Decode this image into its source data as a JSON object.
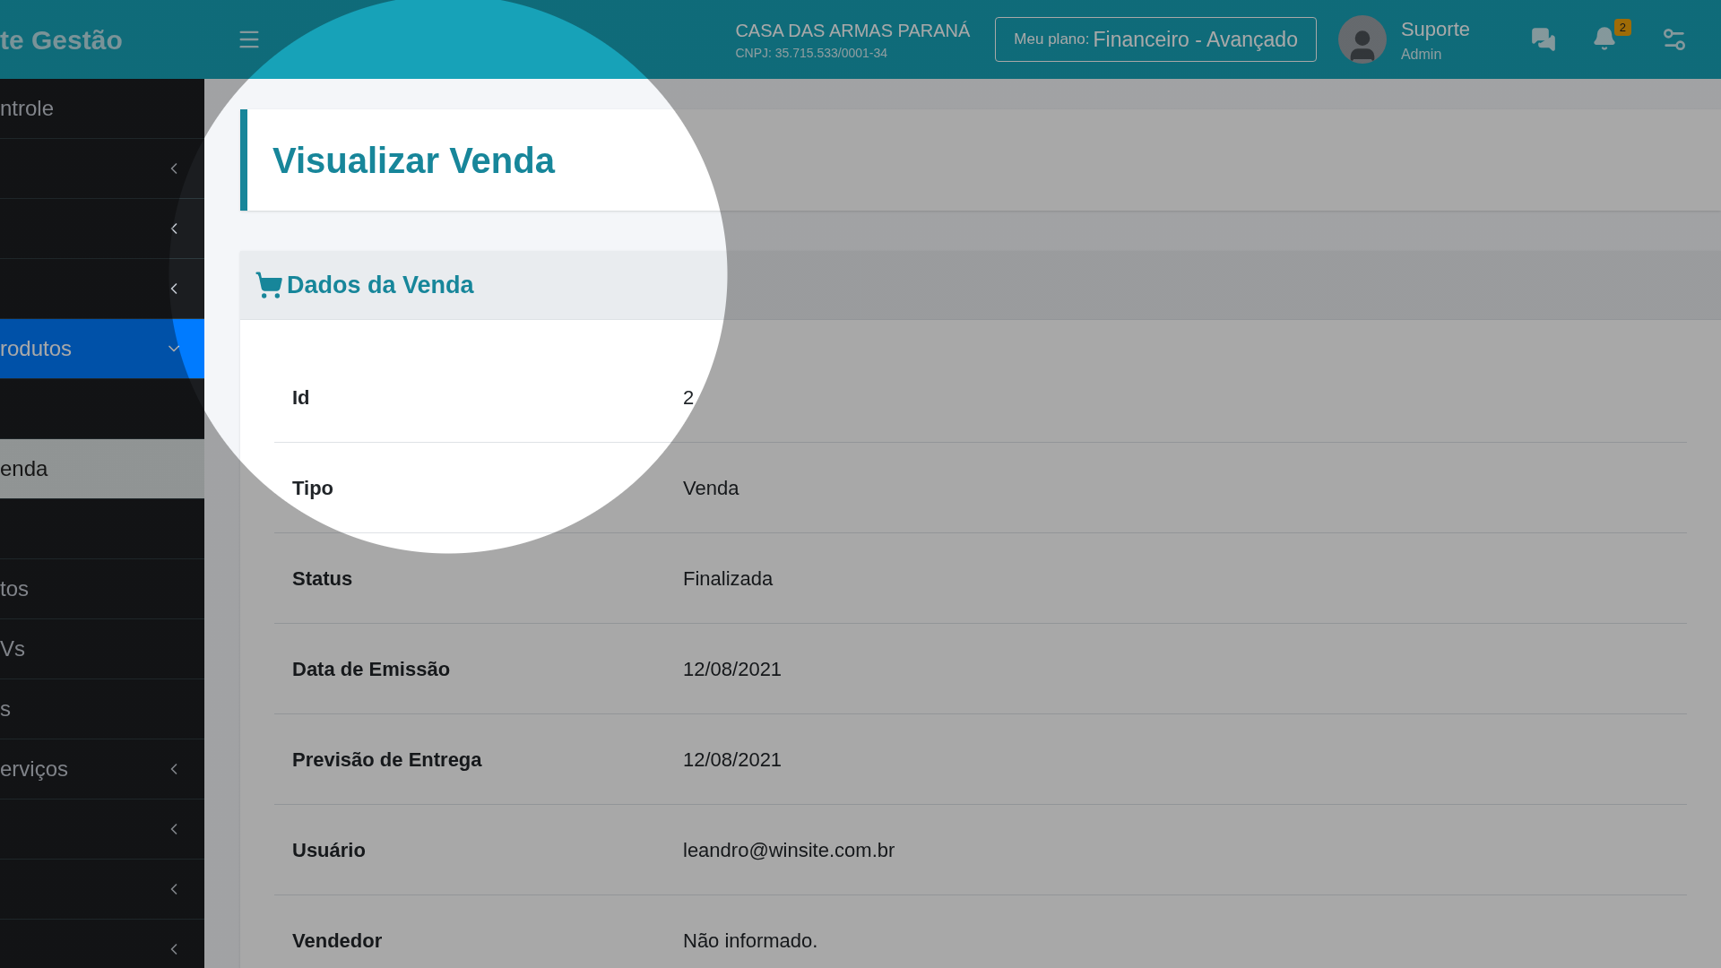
{
  "sidebar": {
    "brand": "te Gestão",
    "items": [
      {
        "label": "ntrole",
        "kind": "link",
        "selected": false
      },
      {
        "kind": "group",
        "expanded": false,
        "selected": false
      },
      {
        "kind": "group",
        "expanded": false,
        "selected": false
      },
      {
        "kind": "group",
        "expanded": false,
        "selected": false
      },
      {
        "label": "rodutos",
        "kind": "group",
        "expanded": true,
        "selected": true
      },
      {
        "kind": "link",
        "selected": false
      },
      {
        "label": "enda",
        "kind": "link",
        "selected": true
      },
      {
        "kind": "link",
        "selected": false
      },
      {
        "label": "tos",
        "kind": "link",
        "selected": false
      },
      {
        "label": "Vs",
        "kind": "link",
        "selected": false
      },
      {
        "label": "s",
        "kind": "link",
        "selected": false
      },
      {
        "label": "erviços",
        "kind": "group",
        "expanded": false,
        "selected": false
      },
      {
        "kind": "group",
        "expanded": false,
        "selected": false
      },
      {
        "kind": "group",
        "expanded": false,
        "selected": false
      },
      {
        "kind": "group",
        "expanded": false,
        "selected": false
      }
    ]
  },
  "topbar": {
    "company": "CASA DAS ARMAS PARANÁ",
    "cnpj": "CNPJ: 35.715.533/0001-34",
    "plan_label": "Meu plano:",
    "plan": "Financeiro - Avançado",
    "user": "Suporte",
    "role": "Admin",
    "notifications": "2"
  },
  "page_title": "Visualizar Venda",
  "details": {
    "title": "Dados da Venda",
    "rows": [
      {
        "label": "Id",
        "value": "2"
      },
      {
        "label": "Tipo",
        "value": "Venda"
      },
      {
        "label": "Status",
        "value": "Finalizada"
      },
      {
        "label": "Data de Emissão",
        "value": "12/08/2021"
      },
      {
        "label": "Previsão de Entrega",
        "value": "12/08/2021"
      },
      {
        "label": "Usuário",
        "value": "leandro@winsite.com.br"
      },
      {
        "label": "Vendedor",
        "value": "Não informado."
      }
    ]
  }
}
